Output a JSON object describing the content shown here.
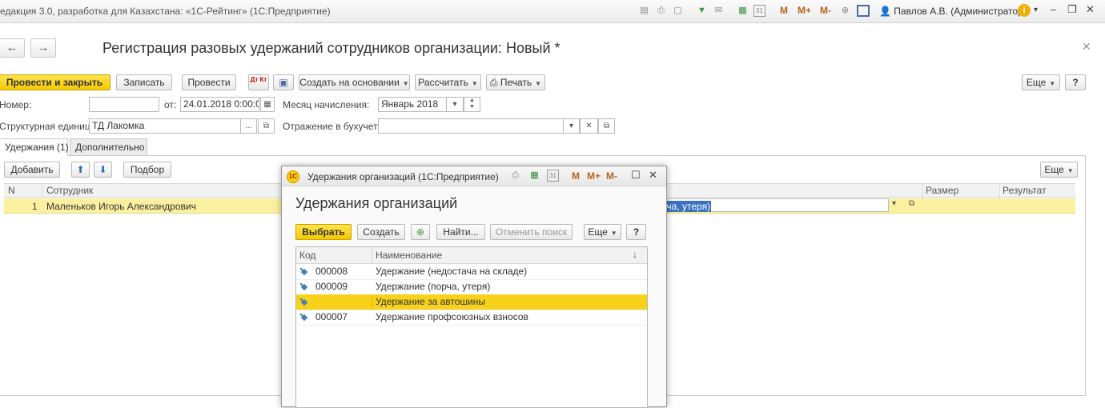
{
  "titlebar": {
    "title": "едакция 3.0, разработка для Казахстана: «1С-Рейтинг»  (1С:Предприятие)",
    "m_labels": [
      "M",
      "M+",
      "M-"
    ],
    "calendar_day": "31",
    "user": "Павлов А.В. (Администратор)"
  },
  "document": {
    "title": "Регистрация разовых удержаний сотрудников организации: Новый *",
    "toolbar": {
      "post_close": "Провести и закрыть",
      "save": "Записать",
      "post": "Провести",
      "dtkt": "Дт Кт",
      "create_based": "Создать на основании",
      "calculate": "Рассчитать",
      "print": "Печать",
      "more": "Еще",
      "help": "?"
    },
    "fields": {
      "number_label": "Номер:",
      "number_value": "",
      "from_label": "от:",
      "date_value": "24.01.2018  0:00:0(",
      "month_label": "Месяц начисления:",
      "month_value": "Январь 2018",
      "unit_label": "Структурная единица:",
      "unit_value": "ТД Лакомка",
      "accounting_label": "Отражение в бухучете:",
      "accounting_value": ""
    },
    "tabs": [
      "Удержания (1)",
      "Дополнительно"
    ],
    "table_toolbar": {
      "add": "Добавить",
      "select": "Подбор",
      "more": "Еще"
    },
    "table": {
      "columns": [
        "N",
        "Сотрудник",
        "Размер",
        "Результат"
      ],
      "rows": [
        {
          "n": "1",
          "employee": "Маленьков Игорь Александрович",
          "deduction_tail": "рча, утеря)",
          "size": "",
          "result": ""
        }
      ]
    }
  },
  "dialog": {
    "window_title": "Удержания организаций  (1С:Предприятие)",
    "logo": "1С",
    "m_labels": [
      "M",
      "M+",
      "M-"
    ],
    "calendar_day": "31",
    "heading": "Удержания организаций",
    "toolbar": {
      "choose": "Выбрать",
      "create": "Создать",
      "find": "Найти...",
      "cancel_search": "Отменить поиск",
      "more": "Еще",
      "help": "?"
    },
    "list": {
      "columns": [
        "Код",
        "Наименование"
      ],
      "sort_indicator": "↓",
      "rows": [
        {
          "code": "000008",
          "name": "Удержание (недостача на складе)"
        },
        {
          "code": "000009",
          "name": "Удержание (порча, утеря)"
        },
        {
          "code": "",
          "name": "Удержание за автошины",
          "selected": true
        },
        {
          "code": "000007",
          "name": "Удержание профсоюзных взносов"
        }
      ]
    }
  },
  "colors": {
    "accent_yellow": "#f5c800",
    "selection_yellow": "#f8d21a",
    "row_highlight": "#fbf0a0",
    "m_buttons": "#b5651d"
  }
}
